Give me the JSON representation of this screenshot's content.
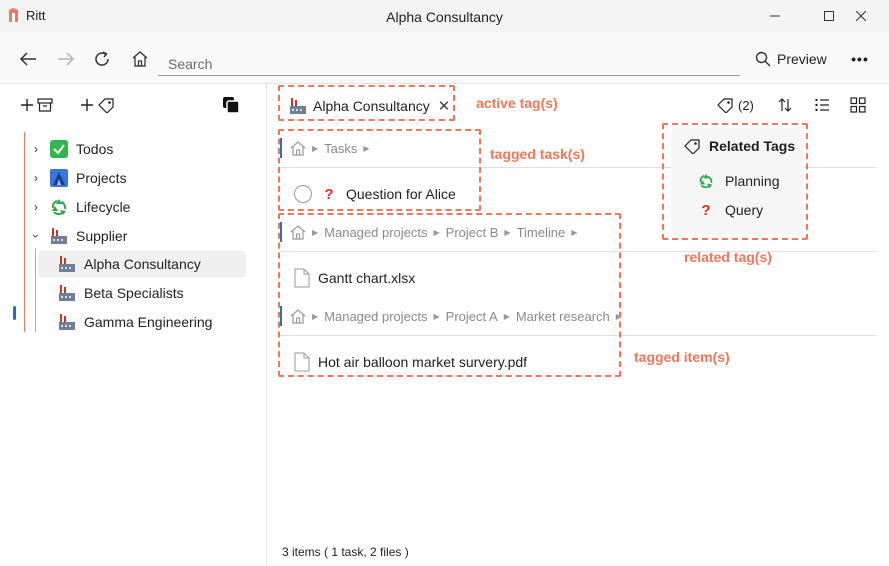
{
  "app": {
    "name": "Ritt",
    "window_title": "Alpha Consultancy"
  },
  "toolbar": {
    "search_placeholder": "Search",
    "preview_label": "Preview",
    "more_label": "•••"
  },
  "sidebar": {
    "tree": [
      {
        "label": "Todos",
        "icon": "green-check-icon"
      },
      {
        "label": "Projects",
        "icon": "blue-tent-icon"
      },
      {
        "label": "Lifecycle",
        "icon": "recycle-icon"
      },
      {
        "label": "Supplier",
        "icon": "factory-icon",
        "expanded": true,
        "children": [
          {
            "label": "Alpha Consultancy",
            "icon": "factory-icon",
            "selected": true
          },
          {
            "label": "Beta Specialists",
            "icon": "factory-icon"
          },
          {
            "label": "Gamma Engineering",
            "icon": "factory-icon"
          }
        ]
      }
    ]
  },
  "main": {
    "active_tag": {
      "label": "Alpha Consultancy",
      "close": "✕"
    },
    "tag_count": "(2)",
    "groups": [
      {
        "crumbs": [
          "Tasks"
        ],
        "items": [
          {
            "type": "task",
            "label": "Question for Alice"
          }
        ]
      },
      {
        "crumbs": [
          "Managed projects",
          "Project B",
          "Timeline"
        ],
        "items": [
          {
            "type": "file",
            "label": "Gantt chart.xlsx"
          }
        ]
      },
      {
        "crumbs": [
          "Managed projects",
          "Project A",
          "Market research"
        ],
        "items": [
          {
            "type": "file",
            "label": "Hot air balloon market survery.pdf"
          }
        ]
      }
    ],
    "related_tags": {
      "title": "Related Tags",
      "items": [
        {
          "label": "Planning",
          "icon": "recycle-icon"
        },
        {
          "label": "Query",
          "icon": "question-icon"
        }
      ]
    },
    "status": "3 items  ( 1 task, 2 files )"
  },
  "annotations": {
    "active_tag": "active tag(s)",
    "tagged_tasks": "tagged task(s)",
    "related_tags": "related tag(s)",
    "tagged_items": "tagged item(s)"
  },
  "colors": {
    "annotation": "#f0785a",
    "accent": "#2f6fbf",
    "tree_line": "#e8806b",
    "tree_line_child": "#6fc4c9"
  }
}
